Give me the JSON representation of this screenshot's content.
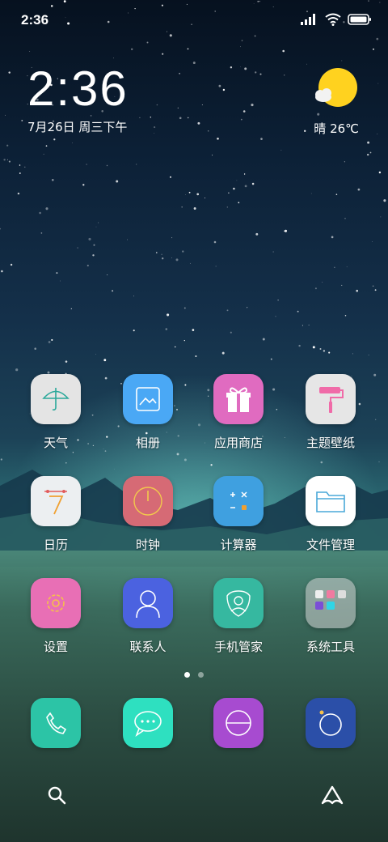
{
  "status_bar": {
    "time": "2:36",
    "icons": [
      "signal-icon",
      "wifi-icon",
      "battery-icon"
    ]
  },
  "clock_widget": {
    "time": "2:36",
    "date": "7月26日 周三下午"
  },
  "weather": {
    "text": "晴 26℃",
    "icon": "sun-cloud-icon"
  },
  "apps": [
    {
      "label": "天气",
      "icon": "umbrella-icon",
      "color": "#e6e6e6"
    },
    {
      "label": "相册",
      "icon": "gallery-icon",
      "color": "#4aa8f5"
    },
    {
      "label": "应用商店",
      "icon": "gift-icon",
      "color": "#e06bc0"
    },
    {
      "label": "主题壁纸",
      "icon": "paint-roller-icon",
      "color": "#eaeaea"
    },
    {
      "label": "日历",
      "icon": "calendar-icon",
      "color": "#eceff1"
    },
    {
      "label": "时钟",
      "icon": "clock-icon",
      "color": "#d66a75"
    },
    {
      "label": "计算器",
      "icon": "calculator-icon",
      "color": "#3fa0e0"
    },
    {
      "label": "文件管理",
      "icon": "folder-icon",
      "color": "#ffffff"
    },
    {
      "label": "设置",
      "icon": "gear-icon",
      "color": "#e86fb5"
    },
    {
      "label": "联系人",
      "icon": "person-icon",
      "color": "#4b62e0"
    },
    {
      "label": "手机管家",
      "icon": "shield-icon",
      "color": "#36b8a0"
    },
    {
      "label": "系统工具",
      "icon": "folder-grid-icon",
      "color": "#cfcfcf"
    }
  ],
  "dock": [
    {
      "icon": "phone-icon",
      "color": "#2cc4a6"
    },
    {
      "icon": "message-icon",
      "color": "#2ee0c0"
    },
    {
      "icon": "browser-icon",
      "color": "#a74bd0"
    },
    {
      "icon": "camera-icon",
      "color": "#2b4fa8"
    }
  ],
  "page_indicator": {
    "count": 2,
    "active": 1
  },
  "bottom_bar": {
    "left": "search-icon",
    "right": "assistant-icon"
  }
}
